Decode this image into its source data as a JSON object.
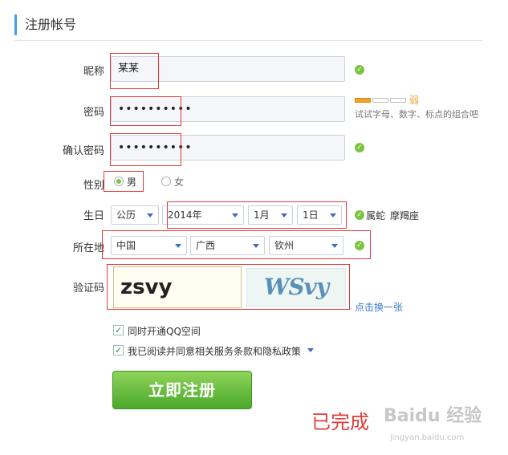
{
  "header": {
    "title": "注册帐号"
  },
  "form": {
    "nickname": {
      "label": "昵称",
      "value": "某某"
    },
    "password": {
      "label": "密码",
      "value": "••••••••••",
      "strength": {
        "text": "弱",
        "level": 0.33,
        "hint": "试试字母、数字、标点的组合吧"
      }
    },
    "confirm": {
      "label": "确认密码",
      "value": "••••••••••"
    },
    "gender": {
      "label": "性别",
      "options": [
        "男",
        "女"
      ],
      "selected": "男"
    },
    "birthday": {
      "label": "生日",
      "calendar": "公历",
      "year": "2014年",
      "month": "1月",
      "day": "1日",
      "zodiac": "属蛇",
      "constellation": "摩羯座"
    },
    "location": {
      "label": "所在地",
      "country": "中国",
      "province": "广西",
      "city": "钦州"
    },
    "captcha": {
      "label": "验证码",
      "value": "zsvy",
      "image_text": "WSvy",
      "refresh_label": "点击换一张"
    },
    "options": {
      "qzone_label": "同时开通QQ空间",
      "qzone_checked": true,
      "agree_label": "我已阅读并同意相关服务条款和隐私政策",
      "agree_checked": true
    },
    "submit_label": "立即注册"
  },
  "annotation": {
    "text": "已完成"
  },
  "watermark": {
    "text": "Baidu 经验",
    "sub": "jingyan.baidu.com"
  },
  "colors": {
    "accent": "#4a9ee8",
    "success": "#7cc33f",
    "button": "#4aa82b",
    "annotation": "#e23b3b",
    "strength": "#f0a030"
  }
}
